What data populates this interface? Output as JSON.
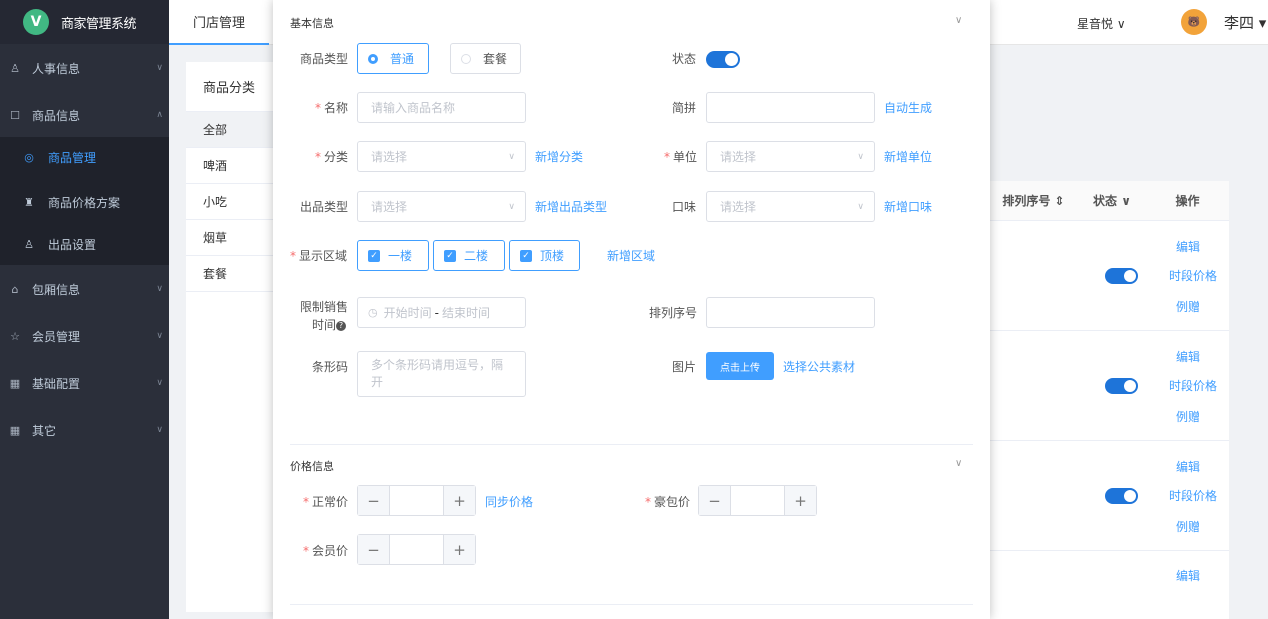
{
  "sidebar": {
    "brand_letter": "V",
    "brand_title": "商家管理系统",
    "items": [
      {
        "icon": "user-icon",
        "glyph": "♙",
        "label": "人事信息"
      },
      {
        "icon": "box-icon",
        "glyph": "☐",
        "label": "商品信息"
      },
      {
        "icon": "home-icon",
        "glyph": "⌂",
        "label": "包厢信息"
      },
      {
        "icon": "star-icon",
        "glyph": "☆",
        "label": "会员管理"
      },
      {
        "icon": "grid-icon",
        "glyph": "▦",
        "label": "基础配置"
      },
      {
        "icon": "grid-icon",
        "glyph": "▦",
        "label": "其它"
      }
    ],
    "sub_items": [
      {
        "icon": "goods-icon",
        "glyph": "◎",
        "label": "商品管理"
      },
      {
        "icon": "bag-icon",
        "glyph": "♜",
        "label": "商品价格方案"
      },
      {
        "icon": "person-icon",
        "glyph": "♙",
        "label": "出品设置"
      }
    ]
  },
  "topbar": {
    "tab": "门店管理",
    "store": "星音悦 ∨",
    "user": "李四 ▾"
  },
  "categories": {
    "title": "商品分类",
    "items": [
      "全部",
      "啤酒",
      "小吃",
      "烟草",
      "套餐"
    ]
  },
  "table": {
    "headers": {
      "sort": "排列序号 ⇕",
      "status": "状态 ∨",
      "actions": "操作"
    },
    "action_labels": {
      "edit": "编辑",
      "time_price": "时段价格",
      "gift": "例赠"
    }
  },
  "modal": {
    "basic_title": "基本信息",
    "price_title": "价格信息",
    "type_label": "商品类型",
    "type_options": [
      "普通",
      "套餐"
    ],
    "status_label": "状态",
    "name_label": "名称",
    "name_placeholder": "请输入商品名称",
    "pinyin_label": "简拼",
    "auto_generate": "自动生成",
    "category_label": "分类",
    "select_placeholder": "请选择",
    "add_category": "新增分类",
    "unit_label": "单位",
    "add_unit": "新增单位",
    "output_type_label": "出品类型",
    "add_output_type": "新增出品类型",
    "taste_label": "口味",
    "add_taste": "新增口味",
    "area_label": "显示区域",
    "areas": [
      "一楼",
      "二楼",
      "顶楼"
    ],
    "add_area": "新增区域",
    "time_label_1": "限制销售",
    "time_label_2": "时间",
    "start_placeholder": "开始时间",
    "time_sep": "-",
    "end_placeholder": "结束时间",
    "sort_label": "排列序号",
    "barcode_label": "条形码",
    "barcode_placeholder": "多个条形码请用逗号，隔开",
    "image_label": "图片",
    "upload_button": "点击上传",
    "public_material": "选择公共素材",
    "normal_price_label": "正常价",
    "sync_price": "同步价格",
    "room_price_label": "豪包价",
    "member_price_label": "会员价"
  }
}
